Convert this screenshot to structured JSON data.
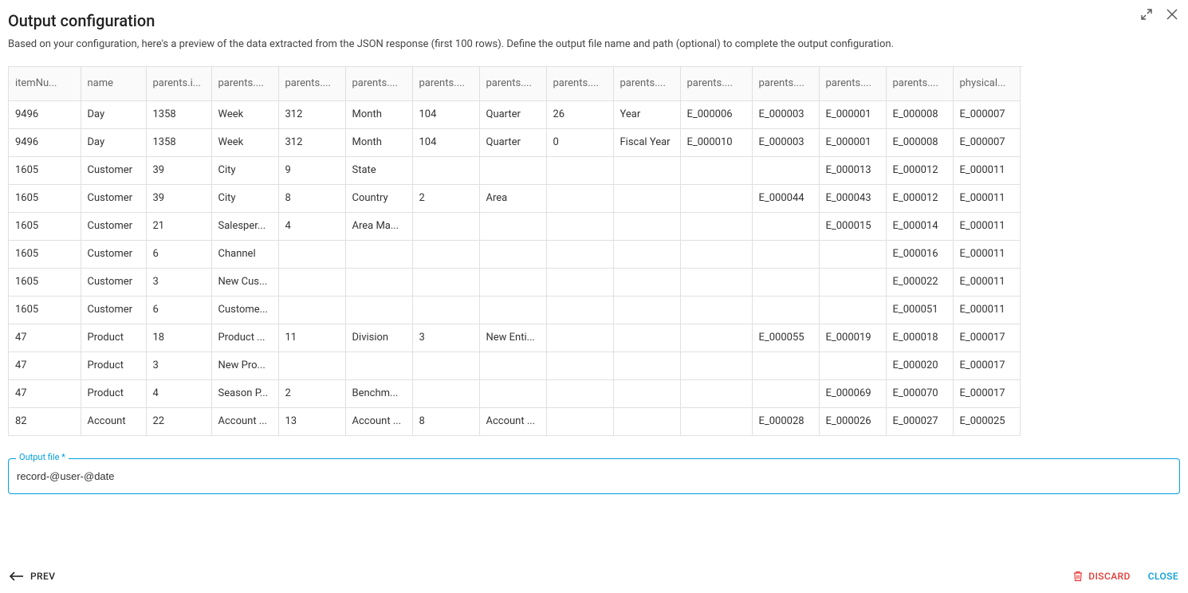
{
  "dialog": {
    "title": "Output configuration",
    "subtitle": "Based on your configuration, here's a preview of the data extracted from the JSON response (first 100 rows). Define the output file name and path (optional) to complete the output configuration."
  },
  "table": {
    "headers": [
      "itemNu...",
      "name",
      "parents.i...",
      "parents....",
      "parents....",
      "parents....",
      "parents....",
      "parents....",
      "parents....",
      "parents....",
      "parents....",
      "parents....",
      "parents....",
      "parents....",
      "physical..."
    ],
    "rows": [
      [
        "9496",
        "Day",
        "1358",
        "Week",
        "312",
        "Month",
        "104",
        "Quarter",
        "26",
        "Year",
        "E_000006",
        "E_000003",
        "E_000001",
        "E_000008",
        "E_000007"
      ],
      [
        "9496",
        "Day",
        "1358",
        "Week",
        "312",
        "Month",
        "104",
        "Quarter",
        "0",
        "Fiscal Year",
        "E_000010",
        "E_000003",
        "E_000001",
        "E_000008",
        "E_000007"
      ],
      [
        "1605",
        "Customer",
        "39",
        "City",
        "9",
        "State",
        "",
        "",
        "",
        "",
        "",
        "",
        "E_000013",
        "E_000012",
        "E_000011"
      ],
      [
        "1605",
        "Customer",
        "39",
        "City",
        "8",
        "Country",
        "2",
        "Area",
        "",
        "",
        "",
        "E_000044",
        "E_000043",
        "E_000012",
        "E_000011"
      ],
      [
        "1605",
        "Customer",
        "21",
        "Salesper...",
        "4",
        "Area Ma...",
        "",
        "",
        "",
        "",
        "",
        "",
        "E_000015",
        "E_000014",
        "E_000011"
      ],
      [
        "1605",
        "Customer",
        "6",
        "Channel",
        "",
        "",
        "",
        "",
        "",
        "",
        "",
        "",
        "",
        "E_000016",
        "E_000011"
      ],
      [
        "1605",
        "Customer",
        "3",
        "New Cus...",
        "",
        "",
        "",
        "",
        "",
        "",
        "",
        "",
        "",
        "E_000022",
        "E_000011"
      ],
      [
        "1605",
        "Customer",
        "6",
        "Custome...",
        "",
        "",
        "",
        "",
        "",
        "",
        "",
        "",
        "",
        "E_000051",
        "E_000011"
      ],
      [
        "47",
        "Product",
        "18",
        "Product ...",
        "11",
        "Division",
        "3",
        "New Enti...",
        "",
        "",
        "",
        "E_000055",
        "E_000019",
        "E_000018",
        "E_000017"
      ],
      [
        "47",
        "Product",
        "3",
        "New Pro...",
        "",
        "",
        "",
        "",
        "",
        "",
        "",
        "",
        "",
        "E_000020",
        "E_000017"
      ],
      [
        "47",
        "Product",
        "4",
        "Season P...",
        "2",
        "Benchm...",
        "",
        "",
        "",
        "",
        "",
        "",
        "E_000069",
        "E_000070",
        "E_000017"
      ],
      [
        "82",
        "Account",
        "22",
        "Account ...",
        "13",
        "Account ...",
        "8",
        "Account ...",
        "",
        "",
        "",
        "E_000028",
        "E_000026",
        "E_000027",
        "E_000025"
      ]
    ]
  },
  "output": {
    "label": "Output file *",
    "value": "record-@user-@date"
  },
  "footer": {
    "prev": "PREV",
    "discard": "DISCARD",
    "close": "CLOSE"
  }
}
